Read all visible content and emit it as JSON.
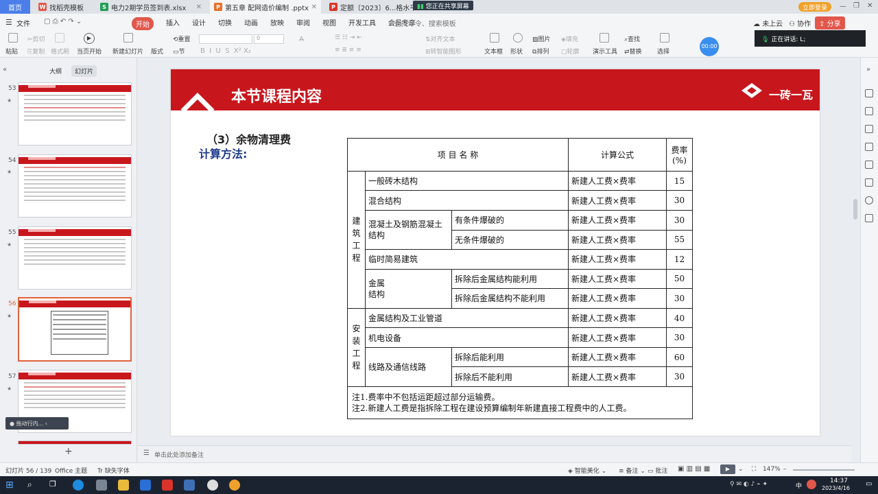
{
  "tabs": [
    {
      "label": "首页",
      "kind": "home"
    },
    {
      "label": "找稻壳模板",
      "kind": "normal"
    },
    {
      "label": "电力2期学员签到表.xlsx",
      "kind": "normal"
    },
    {
      "label": "第五章 配网造价编制 .pptx",
      "kind": "active"
    },
    {
      "label": "定额〔2023〕6...格水平调整",
      "kind": "normal"
    }
  ],
  "share_banner": "您正在共享屏幕",
  "login_button": "立即登录",
  "menus": [
    "文件",
    "开始",
    "插入",
    "设计",
    "切换",
    "动画",
    "放映",
    "审阅",
    "视图",
    "开发工具",
    "会员专享"
  ],
  "search_placeholder": "查找命令、搜索模板",
  "right_menus": {
    "cloud": "未上云",
    "collab": "协作",
    "share": "分享"
  },
  "ribbon": {
    "paste": "粘贴",
    "cut": "剪切",
    "copy": "复制",
    "format_painter": "格式刷",
    "from_current": "当页开始",
    "new_slide": "新建幻灯片",
    "layout": "版式",
    "section": "节",
    "reset": "重置",
    "font_size": "0",
    "align_text": "对齐文本",
    "smartart": "转智能图形",
    "textbox": "文本框",
    "shape": "形状",
    "arrange": "排列",
    "picture": "图片",
    "fill": "填充",
    "outline": "轮廓",
    "presenter": "演示工具",
    "find": "查找",
    "replace": "替换",
    "select": "选择"
  },
  "speaking": {
    "label": "正在讲话: L;",
    "timer": "00:00"
  },
  "left_panel": {
    "tab_outline": "大纲",
    "tab_slides": "幻灯片",
    "tooltip": "拖动行内..."
  },
  "thumbnails": [
    {
      "num": "53"
    },
    {
      "num": "54"
    },
    {
      "num": "55"
    },
    {
      "num": "56",
      "selected": true
    },
    {
      "num": "57"
    }
  ],
  "slide": {
    "title": "本节课程内容",
    "brand": "一砖一瓦",
    "subtitle": "（3）余物清理费",
    "method": "计算方法:",
    "table": {
      "headers": [
        "项 目 名 称",
        "计算公式",
        "费率(%)"
      ],
      "group_building": "建筑工程",
      "group_install": "安装工程",
      "rows": [
        {
          "name": "一般砖木结构",
          "formula": "新建人工费×费率",
          "rate": "15"
        },
        {
          "name": "混合结构",
          "formula": "新建人工费×费率",
          "rate": "30"
        },
        {
          "name": "混凝土及钢筋混凝土结构",
          "sub": "有条件爆破的",
          "formula": "新建人工费×费率",
          "rate": "30"
        },
        {
          "sub": "无条件爆破的",
          "formula": "新建人工费×费率",
          "rate": "55"
        },
        {
          "name": "临时简易建筑",
          "formula": "新建人工费×费率",
          "rate": "12"
        },
        {
          "name": "金属结构",
          "sub": "拆除后金属结构能利用",
          "formula": "新建人工费×费率",
          "rate": "50"
        },
        {
          "sub": "拆除后金属结构不能利用",
          "formula": "新建人工费×费率",
          "rate": "30"
        },
        {
          "name": "金属结构及工业管道",
          "formula": "新建人工费×费率",
          "rate": "40"
        },
        {
          "name": "机电设备",
          "formula": "新建人工费×费率",
          "rate": "30"
        },
        {
          "name": "线路及通信线路",
          "sub": "拆除后能利用",
          "formula": "新建人工费×费率",
          "rate": "60"
        },
        {
          "sub": "拆除后不能利用",
          "formula": "新建人工费×费率",
          "rate": "30"
        }
      ],
      "notes": [
        "注1.费率中不包括运距超过部分运输费。",
        "注2.新建人工费是指拆除工程在建设预算编制年新建直接工程费中的人工费。"
      ]
    }
  },
  "notes_placeholder": "单击此处添加备注",
  "status": {
    "slide_count": "幻灯片 56 / 139",
    "theme": "Office 主题",
    "missing_font": "缺失字体",
    "beautify": "智能美化",
    "notes": "备注",
    "comments": "批注",
    "zoom": "147%"
  },
  "taskbar": {
    "time": "14:37",
    "date": "2023/4/16",
    "ime": "中"
  }
}
